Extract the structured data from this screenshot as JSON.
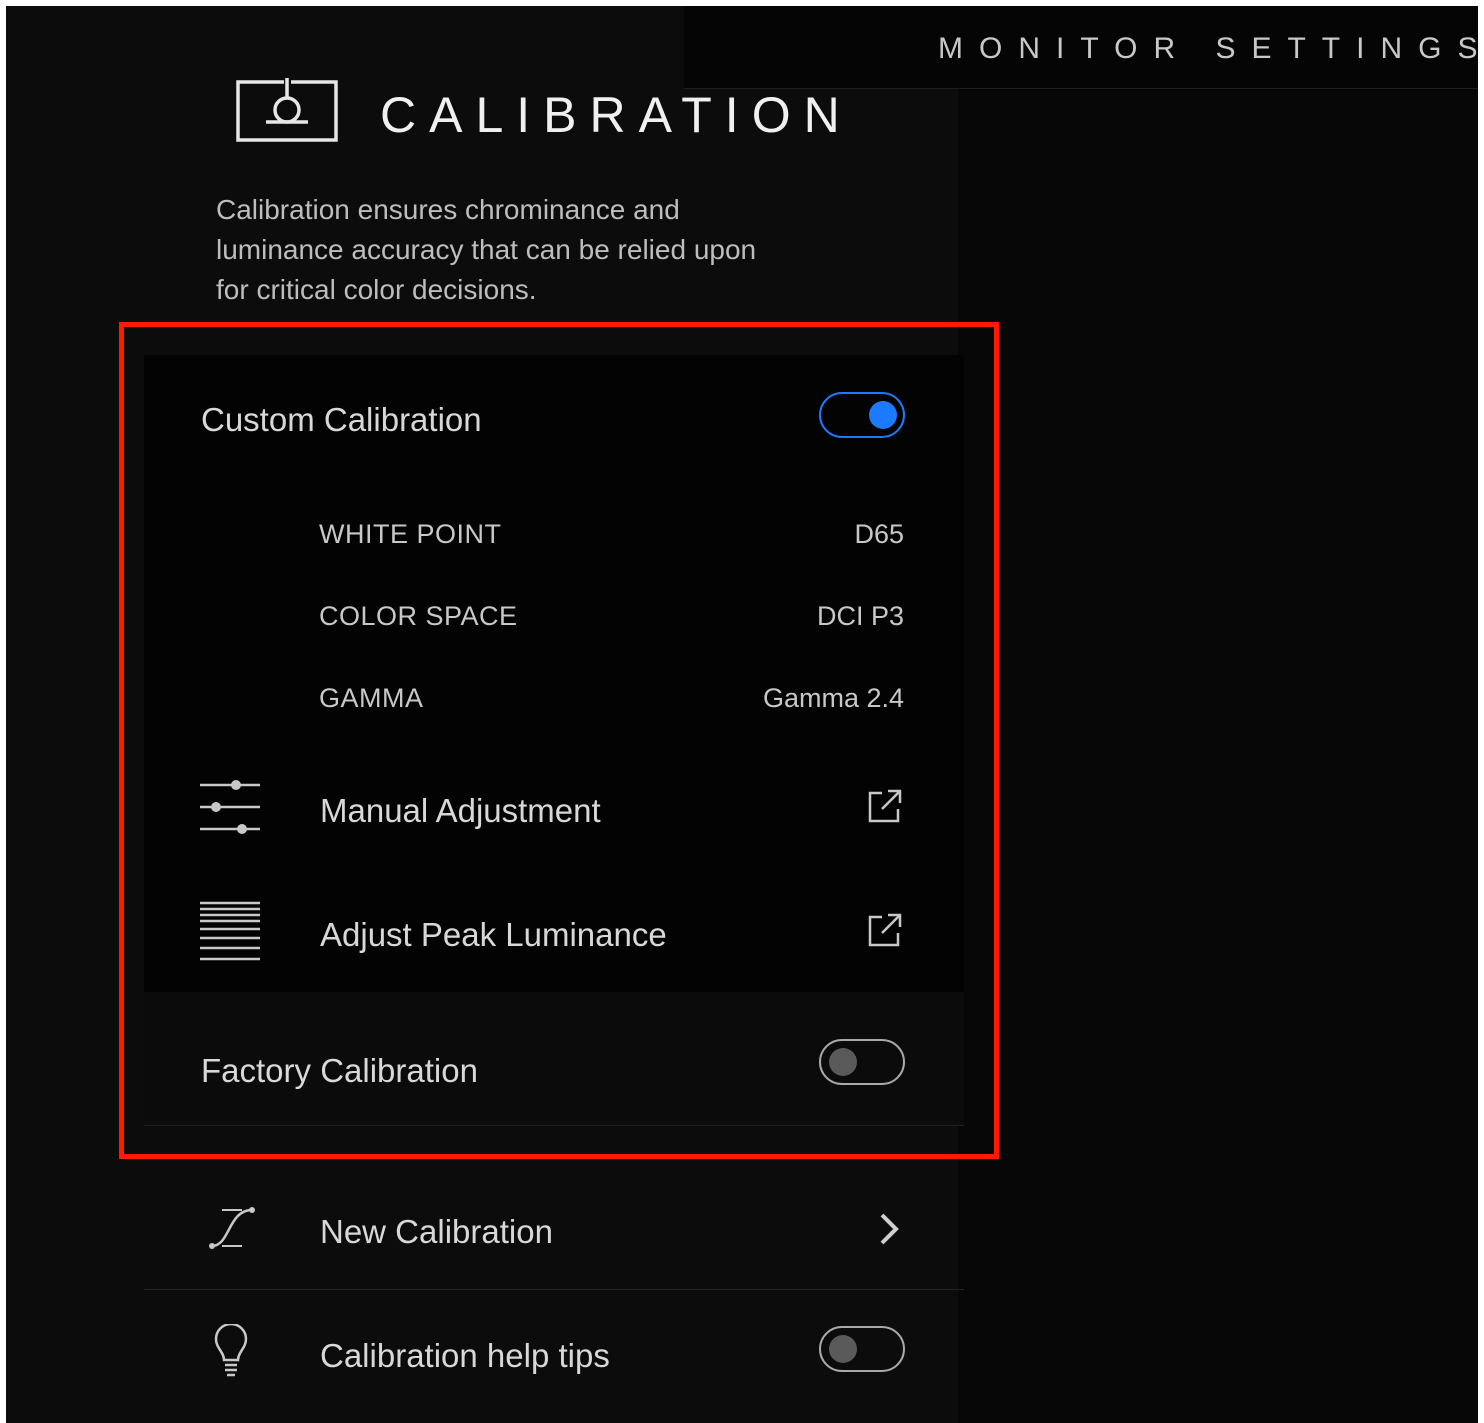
{
  "header": {
    "section_title": "MONITOR SETTINGS",
    "page_title": "CALIBRATION",
    "description_lines": [
      "Calibration ensures chrominance and",
      "luminance accuracy that can be relied upon",
      "for critical color decisions."
    ]
  },
  "custom_calibration": {
    "label": "Custom Calibration",
    "enabled": true,
    "settings": [
      {
        "label": "WHITE POINT",
        "value": "D65"
      },
      {
        "label": "COLOR SPACE",
        "value": "DCI P3"
      },
      {
        "label": "GAMMA",
        "value": "Gamma 2.4"
      }
    ],
    "actions": [
      {
        "label": "Manual Adjustment",
        "icon": "sliders-icon",
        "trailing_icon": "external-link-icon"
      },
      {
        "label": "Adjust Peak Luminance",
        "icon": "luminance-lines-icon",
        "trailing_icon": "external-link-icon"
      }
    ]
  },
  "factory_calibration": {
    "label": "Factory Calibration",
    "enabled": false
  },
  "new_calibration": {
    "label": "New Calibration",
    "icon": "curve-icon",
    "trailing_icon": "chevron-right-icon"
  },
  "help_tips": {
    "label": "Calibration help tips",
    "icon": "lightbulb-icon",
    "enabled": false
  },
  "colors": {
    "accent": "#1a7bff",
    "highlight_border": "#ff1a00",
    "background": "#0c0c0c"
  }
}
